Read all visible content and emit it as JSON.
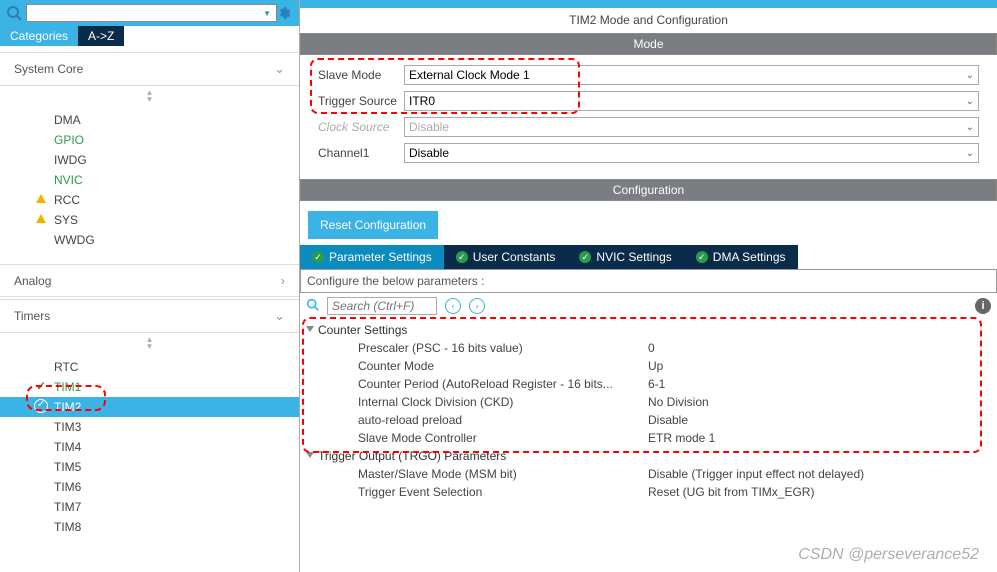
{
  "left": {
    "search_placeholder": "",
    "tabs": {
      "categories": "Categories",
      "az": "A->Z"
    },
    "groups": {
      "system_core": {
        "label": "System Core",
        "items": [
          {
            "label": "DMA"
          },
          {
            "label": "GPIO",
            "green": true
          },
          {
            "label": "IWDG"
          },
          {
            "label": "NVIC",
            "green": true
          },
          {
            "label": "RCC",
            "warn": true
          },
          {
            "label": "SYS",
            "warn": true
          },
          {
            "label": "WWDG"
          }
        ]
      },
      "analog": {
        "label": "Analog"
      },
      "timers": {
        "label": "Timers",
        "items": [
          {
            "label": "RTC"
          },
          {
            "label": "TIM1",
            "green": true,
            "check": true
          },
          {
            "label": "TIM2",
            "sel": true
          },
          {
            "label": "TIM3"
          },
          {
            "label": "TIM4"
          },
          {
            "label": "TIM5"
          },
          {
            "label": "TIM6"
          },
          {
            "label": "TIM7"
          },
          {
            "label": "TIM8"
          }
        ]
      }
    }
  },
  "right": {
    "title": "TIM2 Mode and Configuration",
    "mode_header": "Mode",
    "mode_rows": {
      "slave_mode": {
        "label": "Slave Mode",
        "value": "External Clock Mode 1"
      },
      "trigger_source": {
        "label": "Trigger Source",
        "value": "ITR0"
      },
      "clock_source": {
        "label": "Clock Source",
        "value": "Disable",
        "disabled": true
      },
      "channel1": {
        "label": "Channel1",
        "value": "Disable"
      }
    },
    "config_header": "Configuration",
    "reset_btn": "Reset Configuration",
    "paratabs": {
      "param": "Parameter Settings",
      "user": "User Constants",
      "nvic": "NVIC Settings",
      "dma": "DMA Settings"
    },
    "desc": "Configure the below parameters :",
    "search_placeholder": "Search (Ctrl+F)",
    "groups": {
      "counter": {
        "label": "Counter Settings",
        "rows": [
          {
            "k": "Prescaler (PSC - 16 bits value)",
            "v": "0"
          },
          {
            "k": "Counter Mode",
            "v": "Up"
          },
          {
            "k": "Counter Period (AutoReload Register - 16 bits...",
            "v": "6-1"
          },
          {
            "k": "Internal Clock Division (CKD)",
            "v": "No Division"
          },
          {
            "k": "auto-reload preload",
            "v": "Disable"
          },
          {
            "k": "Slave Mode Controller",
            "v": "ETR mode 1"
          }
        ]
      },
      "trgo": {
        "label": "Trigger Output (TRGO) Parameters",
        "rows": [
          {
            "k": "Master/Slave Mode (MSM bit)",
            "v": "Disable (Trigger input effect not delayed)"
          },
          {
            "k": "Trigger Event Selection",
            "v": "Reset (UG bit from TIMx_EGR)"
          }
        ]
      }
    }
  },
  "watermark": "CSDN @perseverance52"
}
